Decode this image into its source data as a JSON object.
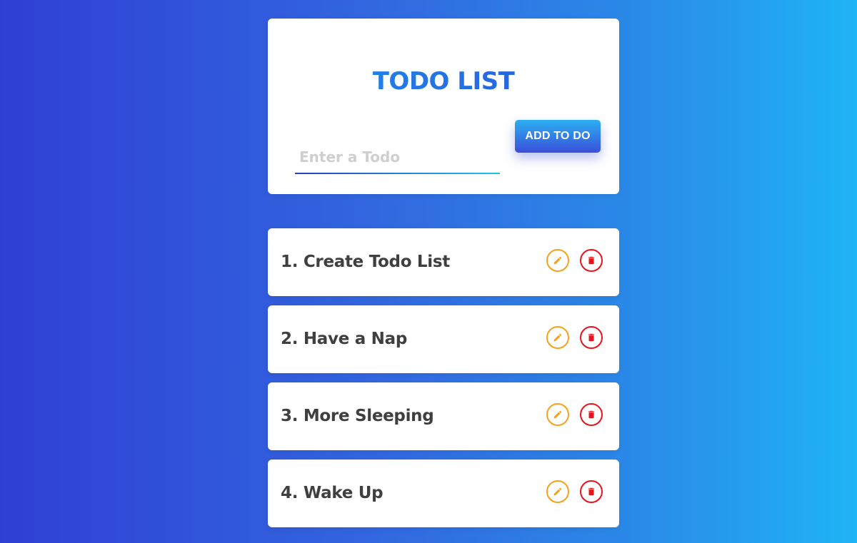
{
  "header": {
    "title": "TODO LIST",
    "input_placeholder": "Enter a Todo",
    "input_value": "",
    "add_button_label": "ADD TO DO"
  },
  "todos": [
    {
      "label": "1. Create Todo List",
      "edit_icon": "pencil-icon",
      "delete_icon": "trash-icon"
    },
    {
      "label": "2. Have a Nap",
      "edit_icon": "pencil-icon",
      "delete_icon": "trash-icon"
    },
    {
      "label": "3. More Sleeping",
      "edit_icon": "pencil-icon",
      "delete_icon": "trash-icon"
    },
    {
      "label": "4. Wake Up",
      "edit_icon": "pencil-icon",
      "delete_icon": "trash-icon"
    }
  ],
  "colors": {
    "background_start": "#2f3fd4",
    "background_end": "#1fb4f5",
    "title_gradient_start": "#1e90f0",
    "title_gradient_end": "#2b55d8",
    "edit_accent": "#f5a21b",
    "delete_accent": "#e8141b",
    "todo_text": "#3f3f3f",
    "placeholder_text": "#cfcfcf"
  }
}
